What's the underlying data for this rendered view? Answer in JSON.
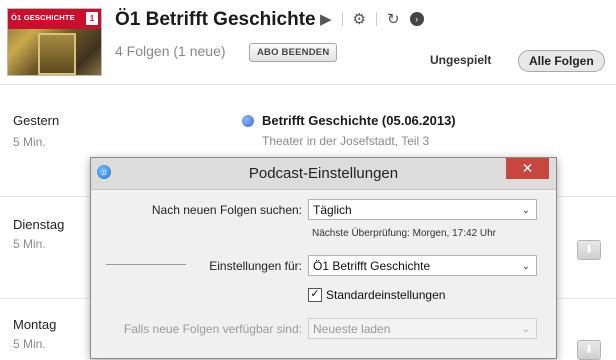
{
  "artwork": {
    "brand": "Ö1 GESCHICHTE",
    "badge": "1"
  },
  "header": {
    "title": "Ö1 Betrifft Geschichte",
    "subtitle": "4 Folgen (1 neue)",
    "unsubscribe_label": "ABO BEENDEN",
    "controls": {
      "play_icon": "▶",
      "settings_icon": "⚙",
      "refresh_icon": "↻",
      "next_icon": "›"
    }
  },
  "filters": {
    "unplayed": "Ungespielt",
    "all": "Alle Folgen"
  },
  "episodes": [
    {
      "day": "Gestern",
      "duration": "5 Min.",
      "title": "Betrifft Geschichte (05.06.2013)",
      "description": "Theater in der Josefstadt, Teil 3"
    },
    {
      "day": "Dienstag",
      "duration": "5 Min."
    },
    {
      "day": "Montag",
      "duration": "5 Min."
    }
  ],
  "download_icon": "⬇",
  "dialog": {
    "title": "Podcast-Einstellungen",
    "close_label": "✕",
    "check_label": "Nach neuen Folgen suchen:",
    "check_value": "Täglich",
    "next_check": "Nächste Überprüfung: Morgen, 17:42 Uhr",
    "settings_for_label": "Einstellungen für:",
    "settings_for_value": "Ö1 Betrifft Geschichte",
    "defaults_label": "Standardeinstellungen",
    "defaults_checked": true,
    "new_episodes_label": "Falls neue Folgen verfügbar sind:",
    "new_episodes_value": "Neueste laden"
  },
  "colors": {
    "accent_dot": "#3a6fd6",
    "close_button": "#c7463d",
    "brand_red": "#c8102e"
  }
}
